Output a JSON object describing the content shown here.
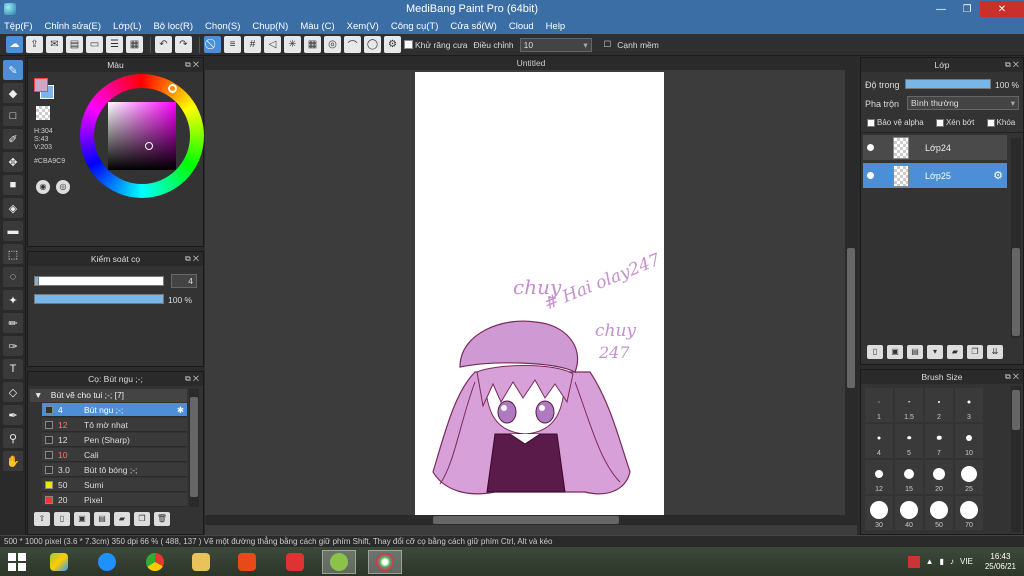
{
  "window": {
    "title": "MediBang Paint Pro (64bit)",
    "minimize": "—",
    "restore": "❐",
    "close": "✕"
  },
  "menu": [
    "Tệp(F)",
    "Chỉnh sửa(E)",
    "Lớp(L)",
    "Bộ lọc(R)",
    "Chọn(S)",
    "Chụp(N)",
    "Màu (C)",
    "Xem(V)",
    "Công cụ(T)",
    "Cửa sổ(W)",
    "Cloud",
    "Help"
  ],
  "toolbar": {
    "antialias_label": "Khử răng cưa",
    "adjust_label": "Điều chỉnh",
    "adjust_value": "10",
    "edge_label": "Cạnh mềm"
  },
  "color_panel": {
    "title": "Màu",
    "h": "H:304",
    "s": "S:43",
    "v": "V:203",
    "hex": "#CBA9C9",
    "fg_color": "#cba9c9",
    "bg_color": "#7fb4e6"
  },
  "brush_control": {
    "title": "Kiểm soát cọ",
    "size_value": "4",
    "opacity_value": "100 %",
    "size_level": 0.04,
    "opacity_level": 1.0
  },
  "brush_list": {
    "title": "Cọ: Bút ngu ;-;",
    "group": "Bút vẽ cho tui ;-; [7]",
    "items": [
      {
        "size": "4",
        "name": "Bút ngu ;-;",
        "color": "#333333",
        "size_color": "#ffffff",
        "selected": true
      },
      {
        "size": "12",
        "name": "Tô mờ nhạt",
        "color": "#333333",
        "size_color": "#ff7766",
        "selected": false
      },
      {
        "size": "12",
        "name": "Pen (Sharp)",
        "color": "#333333",
        "size_color": "#dddddd",
        "selected": false
      },
      {
        "size": "10",
        "name": "Cali",
        "color": "#333333",
        "size_color": "#ff7766",
        "selected": false
      },
      {
        "size": "3.0",
        "name": "Bút tô bóng ;-;",
        "color": "#333333",
        "size_color": "#dddddd",
        "selected": false
      },
      {
        "size": "50",
        "name": "Sumi",
        "color": "#f2e600",
        "size_color": "#dddddd",
        "selected": false
      },
      {
        "size": "20",
        "name": "Pixel",
        "color": "#ff3030",
        "size_color": "#dddddd",
        "selected": false
      }
    ]
  },
  "canvas": {
    "tab_title": "Untitled",
    "sketch_text_1": "chuy",
    "sketch_text_2": "# Hai olay247",
    "sketch_text_3": "chuy",
    "sketch_text_4": "247"
  },
  "layer_panel": {
    "title": "Lớp",
    "opacity_label": "Độ trong",
    "opacity_value": "100 %",
    "blend_label": "Pha trộn",
    "blend_value": "Bình thường",
    "protect_alpha": "Bảo vệ alpha",
    "clip": "Xén bớt",
    "lock": "Khóa",
    "layers": [
      {
        "name": "Lớp24",
        "selected": false
      },
      {
        "name": "Lớp25",
        "selected": true
      }
    ]
  },
  "brush_size": {
    "title": "Brush Size",
    "sizes": [
      "1",
      "1.5",
      "2",
      "3",
      "4",
      "5",
      "7",
      "10",
      "12",
      "15",
      "20",
      "25",
      "30",
      "40",
      "50",
      "70"
    ],
    "dots": [
      1,
      1.5,
      2,
      3,
      3,
      3.5,
      4.5,
      6,
      8,
      10,
      12,
      16,
      18,
      18,
      18,
      18
    ]
  },
  "status": {
    "text": "500 * 1000 pixel   (3.6 * 7.3cm)   350 dpi   66 %   ( 488, 137 )   Vẽ một đường thẳng bằng cách giữ phím Shift, Thay đổi cỡ cọ bằng cách giữ phím Ctrl, Alt và kéo"
  },
  "taskbar": {
    "lang": "VIE",
    "time": "16:43",
    "date": "25/06/21"
  }
}
